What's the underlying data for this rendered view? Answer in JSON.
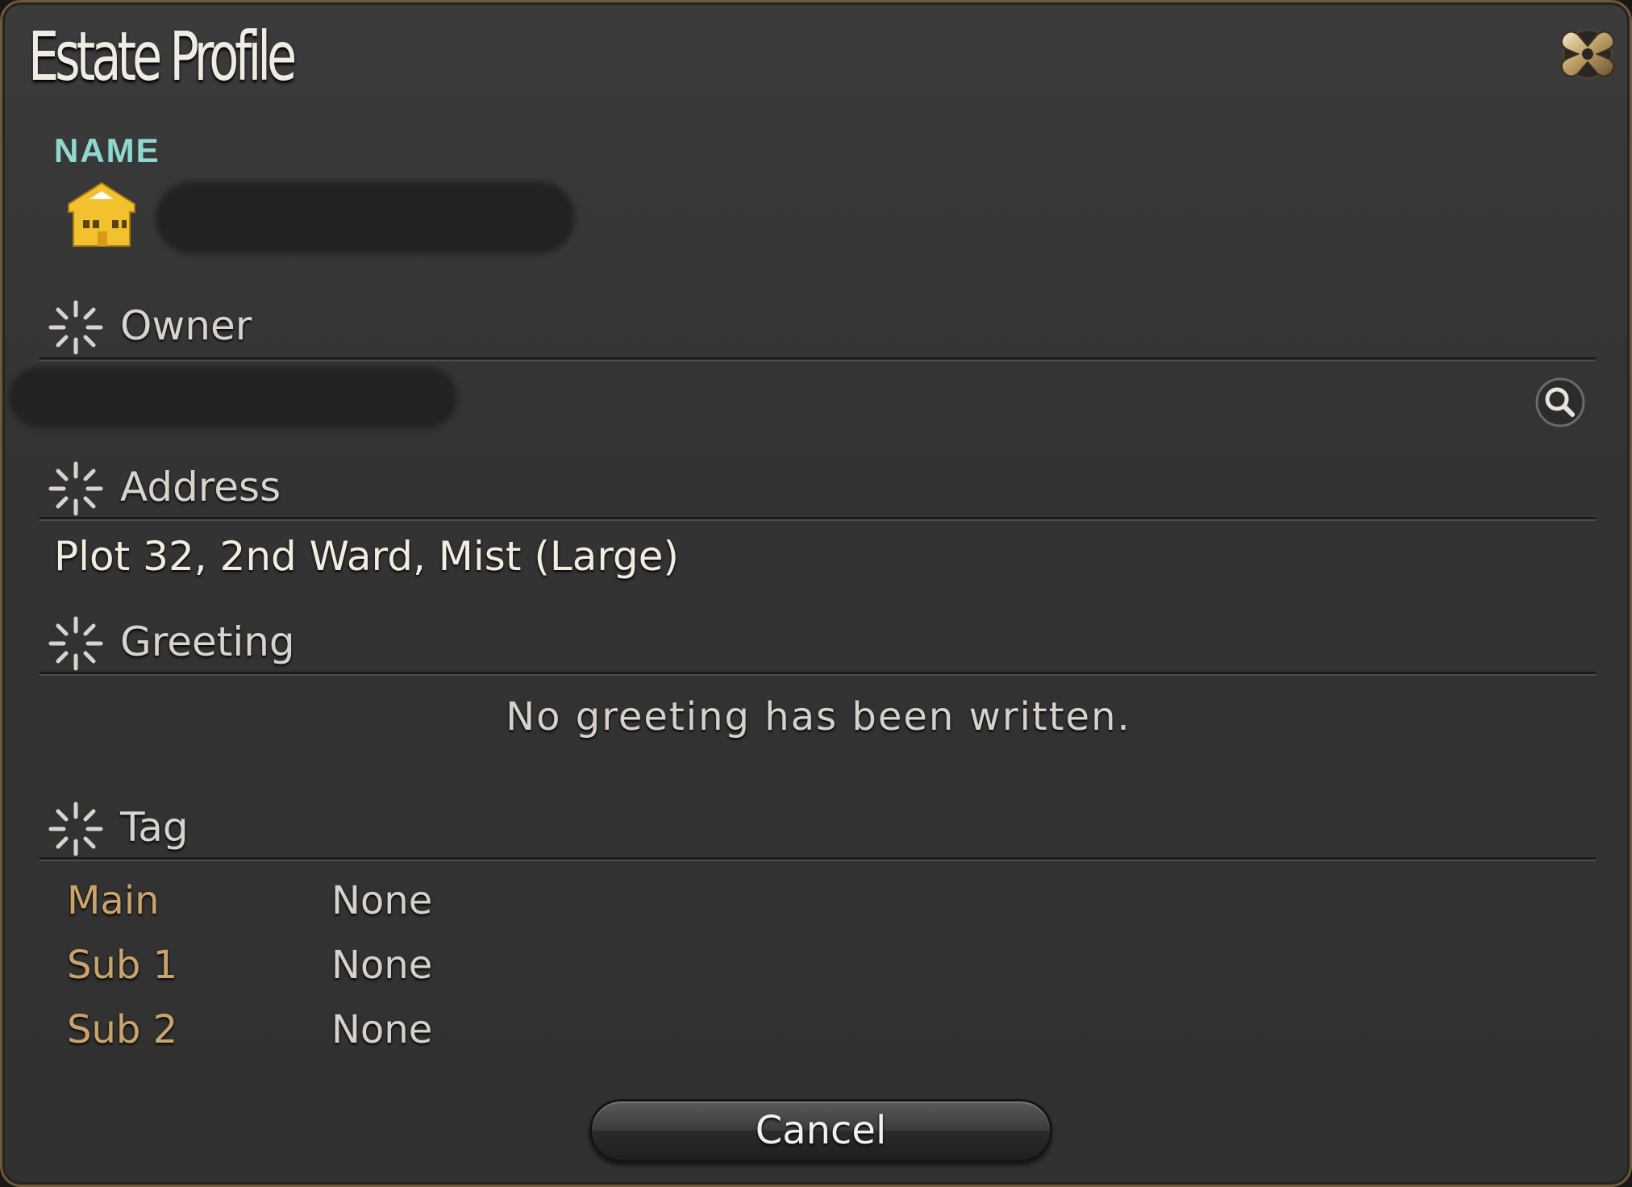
{
  "window": {
    "title": "Estate Profile",
    "close_icon": "close-icon"
  },
  "name_section": {
    "label": "NAME",
    "icon": "house-icon",
    "value_redacted": true
  },
  "owner_section": {
    "label": "Owner",
    "value_redacted": true,
    "search_icon": "search-icon"
  },
  "address_section": {
    "label": "Address",
    "value": "Plot 32, 2nd Ward, Mist (Large)"
  },
  "greeting_section": {
    "label": "Greeting",
    "value": "No greeting has been written."
  },
  "tag_section": {
    "label": "Tag",
    "rows": [
      {
        "key": "Main",
        "value": "None"
      },
      {
        "key": "Sub 1",
        "value": "None"
      },
      {
        "key": "Sub 2",
        "value": "None"
      }
    ]
  },
  "buttons": {
    "cancel_label": "Cancel"
  },
  "colors": {
    "name_label": "#8fd8d2",
    "tag_key": "#c9a56b",
    "house_icon": "#f2c12e"
  }
}
